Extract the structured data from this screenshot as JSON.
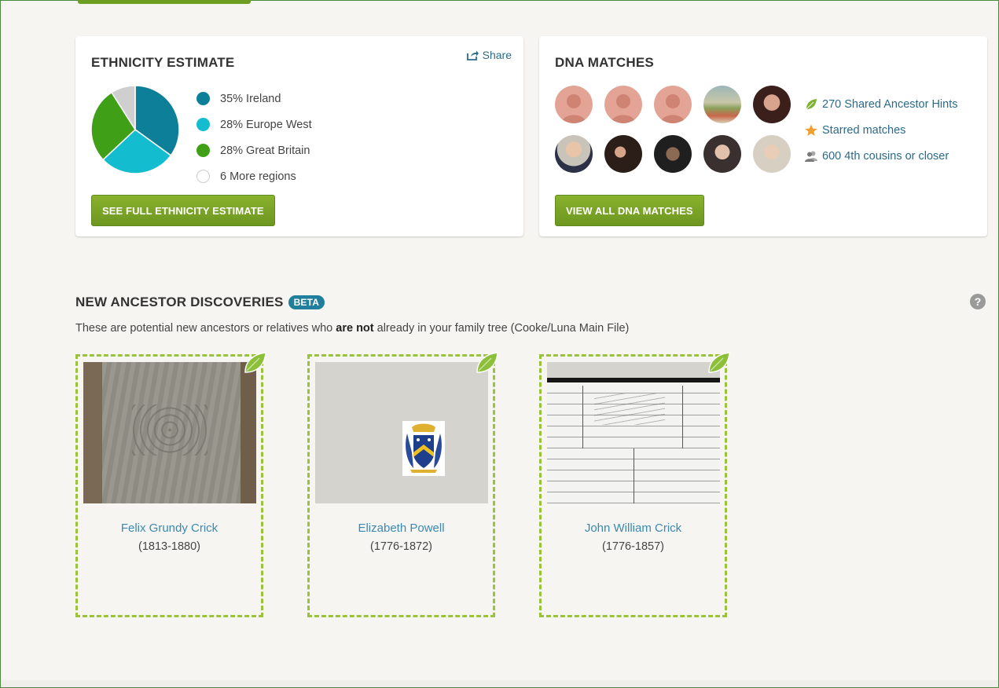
{
  "ethnicity": {
    "title": "ETHNICITY ESTIMATE",
    "share_label": "Share",
    "regions": [
      {
        "label": "35% Ireland",
        "percent": 35,
        "color": "#0e7f99"
      },
      {
        "label": "28% Europe West",
        "percent": 28,
        "color": "#14bcd0"
      },
      {
        "label": "28% Great Britain",
        "percent": 28,
        "color": "#3fa017"
      },
      {
        "label": "6 More regions",
        "percent": 9,
        "color": "#cfcfcf"
      }
    ],
    "button_label": "SEE FULL ETHNICITY ESTIMATE"
  },
  "dna": {
    "title": "DNA MATCHES",
    "links": [
      {
        "label": "270 Shared Ancestor Hints",
        "icon": "leaf-icon",
        "color": "#7ab32e"
      },
      {
        "label": "Starred matches",
        "icon": "star-icon",
        "color": "#f0a030"
      },
      {
        "label": "600 4th cousins or closer",
        "icon": "people-icon",
        "color": "#8a8a8a"
      }
    ],
    "button_label": "VIEW ALL DNA MATCHES"
  },
  "discoveries": {
    "title": "NEW ANCESTOR DISCOVERIES",
    "badge": "BETA",
    "subtitle_pre": "These are potential new ancestors or relatives who ",
    "subtitle_bold": "are not",
    "subtitle_post": " already in your family tree (Cooke/Luna Main File)",
    "cards": [
      {
        "name": "Felix Grundy Crick",
        "years": "(1813-1880)",
        "image": "gravestone"
      },
      {
        "name": "Elizabeth Powell",
        "years": "(1776-1872)",
        "image": "coat-of-arms"
      },
      {
        "name": "John William Crick",
        "years": "(1776-1857)",
        "image": "war-record"
      }
    ]
  },
  "colors": {
    "accent_green": "#7ba428",
    "link_blue": "#2b6a8a",
    "dash_green": "#9bc23c"
  }
}
